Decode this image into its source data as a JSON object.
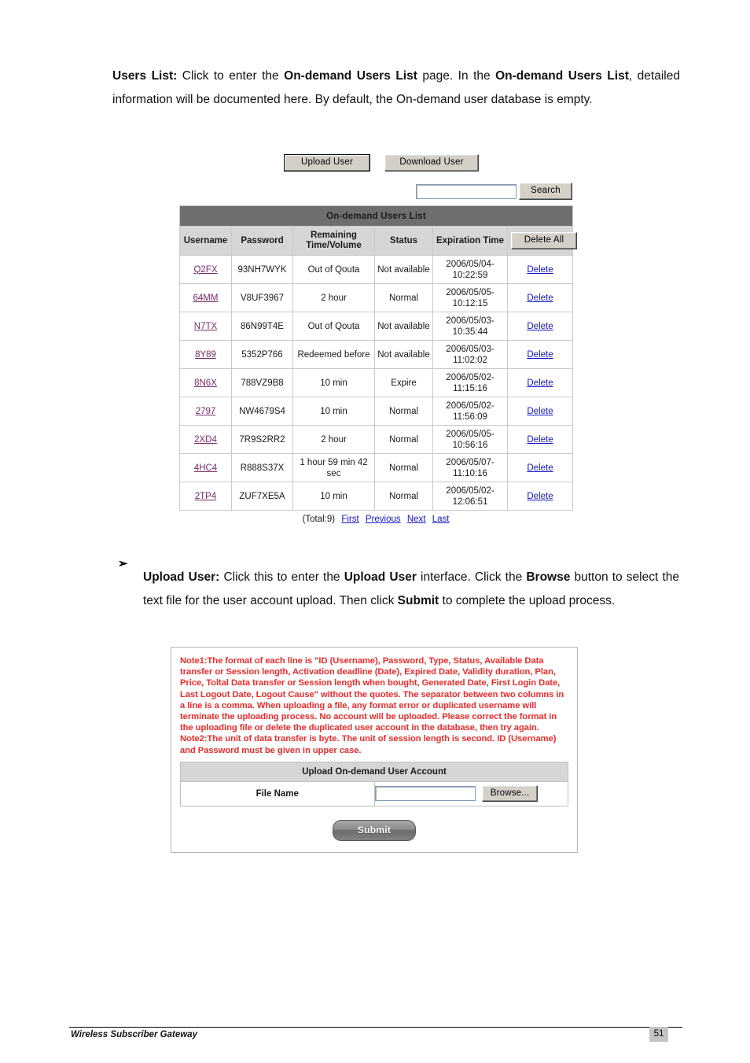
{
  "document": {
    "footer_title": "Wireless Subscriber Gateway",
    "page_number": "51"
  },
  "paragraphs": {
    "users_list_intro": {
      "lead": "Users List:",
      "rest_1": " Click to enter the ",
      "bold_1": "On-demand Users List",
      "rest_2": " page. In the ",
      "bold_2": "On-demand Users List",
      "rest_3": ", detailed information will be documented here. By default, the On-demand user database is empty."
    },
    "upload_user_intro": {
      "bullet": "➢",
      "lead": "Upload User:",
      "rest_1": " Click this to enter the ",
      "bold_1": "Upload User",
      "rest_2": " interface. Click the ",
      "bold_2": "Browse",
      "rest_3": " button to select the text file for the user account upload. Then click ",
      "bold_3": "Submit",
      "rest_4": " to complete the upload process."
    }
  },
  "users_list_screen": {
    "toolbar": {
      "upload_user_label": "Upload User",
      "download_user_label": "Download User"
    },
    "search": {
      "value": "",
      "placeholder": "",
      "button_label": "Search"
    },
    "table": {
      "title": "On-demand Users List",
      "columns": [
        "Username",
        "Password",
        "Remaining Time/Volume",
        "Status",
        "Expiration Time"
      ],
      "column_remaining_line1": "Remaining",
      "column_remaining_line2": "Time/Volume",
      "delete_all_label": "Delete All",
      "row_action_label": "Delete",
      "rows": [
        {
          "username": "Q2FX",
          "password": "93NH7WYK",
          "remaining": "Out of Qouta",
          "status": "Not available",
          "expiration_date": "2006/05/04-",
          "expiration_time": "10:22:59",
          "action": "Delete"
        },
        {
          "username": "64MM",
          "password": "V8UF3967",
          "remaining": "2 hour",
          "status": "Normal",
          "expiration_date": "2006/05/05-",
          "expiration_time": "10:12:15",
          "action": "Delete"
        },
        {
          "username": "N7TX",
          "password": "86N99T4E",
          "remaining": "Out of Qouta",
          "status": "Not available",
          "expiration_date": "2006/05/03-",
          "expiration_time": "10:35:44",
          "action": "Delete"
        },
        {
          "username": "8Y89",
          "password": "5352P766",
          "remaining": "Redeemed before",
          "status": "Not available",
          "expiration_date": "2006/05/03-",
          "expiration_time": "11:02:02",
          "action": "Delete"
        },
        {
          "username": "8N6X",
          "password": "788VZ9B8",
          "remaining": "10 min",
          "status": "Expire",
          "expiration_date": "2006/05/02-",
          "expiration_time": "11:15:16",
          "action": "Delete"
        },
        {
          "username": "2797",
          "password": "NW4679S4",
          "remaining": "10 min",
          "status": "Normal",
          "expiration_date": "2006/05/02-",
          "expiration_time": "11:56:09",
          "action": "Delete"
        },
        {
          "username": "2XD4",
          "password": "7R9S2RR2",
          "remaining": "2 hour",
          "status": "Normal",
          "expiration_date": "2006/05/05-",
          "expiration_time": "10:56:16",
          "action": "Delete"
        },
        {
          "username": "4HC4",
          "password": "R888S37X",
          "remaining": "1 hour 59 min 42 sec",
          "status": "Normal",
          "expiration_date": "2006/05/07-",
          "expiration_time": "11:10:16",
          "action": "Delete"
        },
        {
          "username": "2TP4",
          "password": "ZUF7XE5A",
          "remaining": "10 min",
          "status": "Normal",
          "expiration_date": "2006/05/02-",
          "expiration_time": "12:06:51",
          "action": "Delete"
        }
      ]
    },
    "pager": {
      "total": "(Total:9)",
      "first": "First",
      "previous": "Previous",
      "next": "Next",
      "last": "Last"
    }
  },
  "upload_screen": {
    "note": "Note1:The format of each line is \"ID (Username), Password, Type, Status, Available Data transfer or Session length, Activation deadline (Date), Expired Date, Validity duration, Plan, Price, Toltal Data transfer or Session length when bought, Generated Date, First Login Date, Last Logout Date, Logout Cause\" without the quotes. The separator between two columns in a line is a comma. When uploading a file, any format error or duplicated username will terminate the uploading process. No account will be uploaded. Please correct the format in the uploading file or delete the duplicated user account in the database, then try again. Note2:The unit of data transfer is byte. The unit of session length is second. ID (Username) and Password must be given in upper case.",
    "form_title": "Upload On-demand User Account",
    "file_name_label": "File Name",
    "file_name_value": "",
    "browse_label": "Browse...",
    "submit_label": "Submit"
  },
  "colors": {
    "table_title_bg": "#6e6e6e",
    "table_header_bg": "#d6d6d6",
    "note_red": "#ee2a2a",
    "username_link": "#7a2a6a",
    "delete_link": "#1414cc"
  }
}
